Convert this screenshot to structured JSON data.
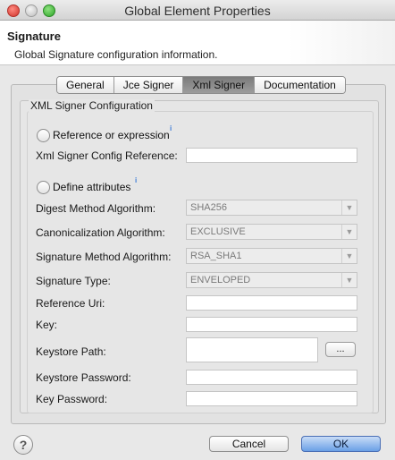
{
  "window": {
    "title": "Global Element Properties"
  },
  "header": {
    "title": "Signature",
    "description": "Global Signature configuration information."
  },
  "tabs": [
    {
      "label": "General",
      "active": false
    },
    {
      "label": "Jce Signer",
      "active": false
    },
    {
      "label": "Xml Signer",
      "active": true
    },
    {
      "label": "Documentation",
      "active": false
    }
  ],
  "group": {
    "title": "XML Signer Configuration"
  },
  "form": {
    "radio_reference": {
      "label": "Reference or expression",
      "selected": false
    },
    "config_ref": {
      "label": "Xml Signer Config Reference:",
      "value": ""
    },
    "radio_define": {
      "label": "Define attributes",
      "selected": false
    },
    "digest": {
      "label": "Digest Method Algorithm:",
      "value": "SHA256"
    },
    "canonicalization": {
      "label": "Canonicalization Algorithm:",
      "value": "EXCLUSIVE"
    },
    "signature_method": {
      "label": "Signature Method Algorithm:",
      "value": "RSA_SHA1"
    },
    "signature_type": {
      "label": "Signature Type:",
      "value": "ENVELOPED"
    },
    "reference_uri": {
      "label": "Reference Uri:",
      "value": ""
    },
    "key": {
      "label": "Key:",
      "value": ""
    },
    "keystore_path": {
      "label": "Keystore Path:",
      "value": ""
    },
    "browse": {
      "label": "..."
    },
    "keystore_password": {
      "label": "Keystore Password:",
      "value": ""
    },
    "key_password": {
      "label": "Key Password:",
      "value": ""
    }
  },
  "info_icon": {
    "glyph": "i",
    "color": "#3d7dd8"
  },
  "footer": {
    "help": "?",
    "cancel": "Cancel",
    "ok": "OK"
  },
  "colors": {
    "ok_button": "#6aa0e6",
    "active_tab": "#8a8a8a"
  }
}
